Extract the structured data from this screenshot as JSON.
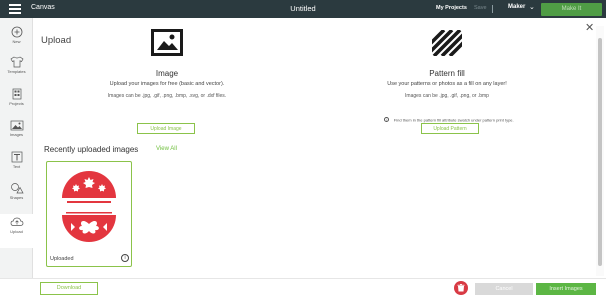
{
  "topbar": {
    "app_name": "Canvas",
    "title": "Untitled",
    "my_projects": "My Projects",
    "save": "Save",
    "machine": "Maker",
    "make_it": "Make It"
  },
  "sidebar": {
    "items": [
      {
        "label": "New",
        "icon": "plus-circle-icon"
      },
      {
        "label": "Templates",
        "icon": "shirt-icon"
      },
      {
        "label": "Projects",
        "icon": "projects-icon"
      },
      {
        "label": "Images",
        "icon": "image-icon"
      },
      {
        "label": "Text",
        "icon": "text-icon"
      },
      {
        "label": "Shapes",
        "icon": "shapes-icon"
      },
      {
        "label": "Upload",
        "icon": "cloud-upload-icon"
      }
    ]
  },
  "main": {
    "heading": "Upload",
    "image_col": {
      "title": "Image",
      "desc1": "Upload your images for free (basic and vector).",
      "desc2": "Images can be .jpg, .gif, .png, .bmp, .svg, or .dxf files.",
      "button": "Upload Image"
    },
    "pattern_col": {
      "title": "Pattern fill",
      "desc1": "Use your patterns or photos as a fill on any layer!",
      "desc2": "Images can be .jpg, .gif, .png, or .bmp",
      "note": "Find them in the pattern fill attribute swatch under pattern print type.",
      "button": "Upload Pattern"
    },
    "recent_title": "Recently uploaded images",
    "view_all": "View All",
    "card_caption": "Uploaded"
  },
  "footer": {
    "download": "Download",
    "cancel": "Cancel",
    "insert": "Insert Images"
  },
  "colors": {
    "accent": "#8bc34a",
    "topbar": "#2b3a3f",
    "danger": "#d83a44",
    "image_red": "#e3363f"
  }
}
